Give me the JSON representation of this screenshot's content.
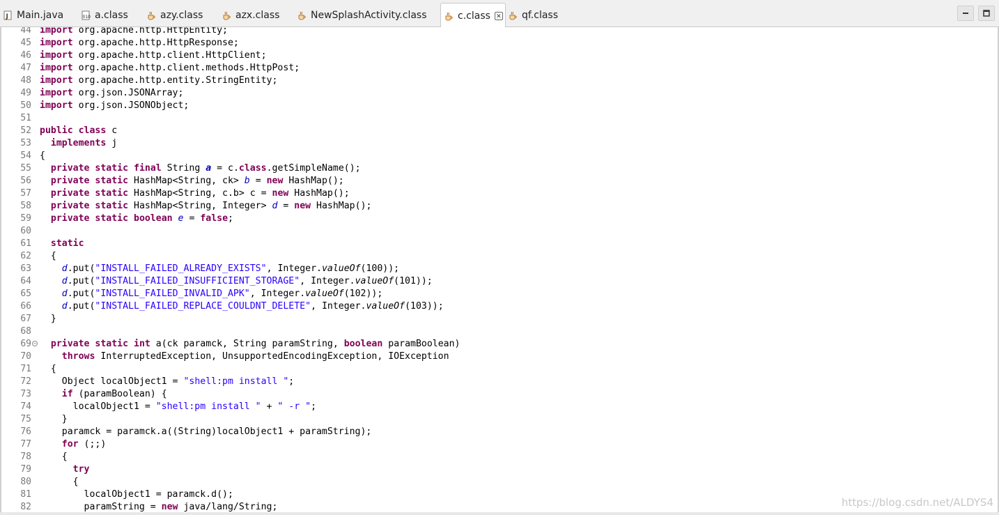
{
  "tabs": [
    {
      "label": "Main.java",
      "icon": "java-file-icon"
    },
    {
      "label": "a.class",
      "icon": "class-file-icon"
    },
    {
      "label": "azy.class",
      "icon": "class-file-icon"
    },
    {
      "label": "azx.class",
      "icon": "class-file-icon"
    },
    {
      "label": "NewSplashActivity.class",
      "icon": "class-file-icon"
    },
    {
      "label": "c.class",
      "icon": "class-file-icon",
      "active": true
    },
    {
      "label": "qf.class",
      "icon": "class-file-icon"
    }
  ],
  "window_buttons": {
    "minimize": "minimize-icon",
    "maximize": "maximize-icon"
  },
  "code_lines": [
    {
      "n": "44",
      "text": "import org.apache.http.HttpEntity;"
    },
    {
      "n": "45",
      "text": "import org.apache.http.HttpResponse;"
    },
    {
      "n": "46",
      "text": "import org.apache.http.client.HttpClient;"
    },
    {
      "n": "47",
      "text": "import org.apache.http.client.methods.HttpPost;"
    },
    {
      "n": "48",
      "text": "import org.apache.http.entity.StringEntity;"
    },
    {
      "n": "49",
      "text": "import org.json.JSONArray;"
    },
    {
      "n": "50",
      "text": "import org.json.JSONObject;"
    },
    {
      "n": "51",
      "text": ""
    },
    {
      "n": "52",
      "text": "public class c"
    },
    {
      "n": "53",
      "text": "  implements j"
    },
    {
      "n": "54",
      "text": "{"
    },
    {
      "n": "55",
      "text": "  private static final String a = c.class.getSimpleName();"
    },
    {
      "n": "56",
      "text": "  private static HashMap<String, ck> b = new HashMap();"
    },
    {
      "n": "57",
      "text": "  private static HashMap<String, c.b> c = new HashMap();"
    },
    {
      "n": "58",
      "text": "  private static HashMap<String, Integer> d = new HashMap();"
    },
    {
      "n": "59",
      "text": "  private static boolean e = false;"
    },
    {
      "n": "60",
      "text": ""
    },
    {
      "n": "61",
      "text": "  static"
    },
    {
      "n": "62",
      "text": "  {"
    },
    {
      "n": "63",
      "text": "    d.put(\"INSTALL_FAILED_ALREADY_EXISTS\", Integer.valueOf(100));"
    },
    {
      "n": "64",
      "text": "    d.put(\"INSTALL_FAILED_INSUFFICIENT_STORAGE\", Integer.valueOf(101));"
    },
    {
      "n": "65",
      "text": "    d.put(\"INSTALL_FAILED_INVALID_APK\", Integer.valueOf(102));"
    },
    {
      "n": "66",
      "text": "    d.put(\"INSTALL_FAILED_REPLACE_COULDNT_DELETE\", Integer.valueOf(103));"
    },
    {
      "n": "67",
      "text": "  }"
    },
    {
      "n": "68",
      "text": ""
    },
    {
      "n": "69",
      "text": "  private static int a(ck paramck, String paramString, boolean paramBoolean)",
      "fold": true
    },
    {
      "n": "70",
      "text": "    throws InterruptedException, UnsupportedEncodingException, IOException"
    },
    {
      "n": "71",
      "text": "  {"
    },
    {
      "n": "72",
      "text": "    Object localObject1 = \"shell:pm install \";"
    },
    {
      "n": "73",
      "text": "    if (paramBoolean) {"
    },
    {
      "n": "74",
      "text": "      localObject1 = \"shell:pm install \" + \" -r \";"
    },
    {
      "n": "75",
      "text": "    }"
    },
    {
      "n": "76",
      "text": "    paramck = paramck.a((String)localObject1 + paramString);"
    },
    {
      "n": "77",
      "text": "    for (;;)"
    },
    {
      "n": "78",
      "text": "    {"
    },
    {
      "n": "79",
      "text": "      try"
    },
    {
      "n": "80",
      "text": "      {"
    },
    {
      "n": "81",
      "text": "        localObject1 = paramck.d();"
    },
    {
      "n": "82",
      "text": "        paramString = new java/lang/String;"
    }
  ],
  "watermark": "https://blog.csdn.net/ALDYS4"
}
